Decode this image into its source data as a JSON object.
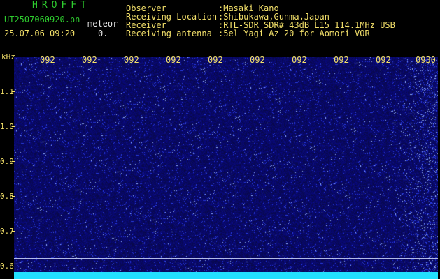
{
  "header": {
    "title": "HROFFT",
    "filename": "UT2507060920.pn",
    "mode": "meteor",
    "datetime": "25.07.06 09:20",
    "count": "0._",
    "fields": [
      {
        "label": "Observer",
        "value": ":Masaki Kano"
      },
      {
        "label": "Receiving Location",
        "value": ":Shibukawa,Gunma,Japan"
      },
      {
        "label": "Receiver",
        "value": ":RTL-SDR SDR# 43dB L15 114.1MHz USB"
      },
      {
        "label": "Receiving antenna",
        "value": ":5el Yagi Az 20 for Aomori VOR"
      }
    ]
  },
  "spectrogram": {
    "y_unit": "kHz",
    "y_ticks": [
      "1.1",
      "1.0",
      "0.9",
      "0.8",
      "0.7",
      "0.6"
    ],
    "x_ticks": [
      "092",
      "092",
      "092",
      "092",
      "092",
      "092",
      "092",
      "092",
      "092",
      "0930"
    ],
    "colors": {
      "background": "#0a0a5a",
      "noise": "#22e0ff",
      "text": "#f3e06a"
    }
  }
}
